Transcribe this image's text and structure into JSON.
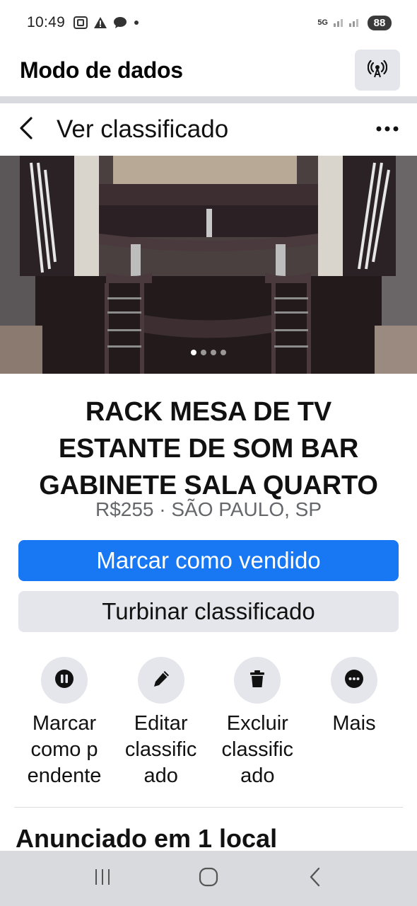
{
  "status_bar": {
    "time": "10:49",
    "network": "5G",
    "battery": "88",
    "left_icons": [
      "screenshot-icon",
      "alert-icon",
      "chat-icon",
      "dot-icon"
    ]
  },
  "data_mode": {
    "title": "Modo de dados",
    "icon": "broadcast-icon"
  },
  "header": {
    "title": "Ver classificado",
    "back_icon": "chevron-left-icon",
    "more_icon": "more-horizontal-icon"
  },
  "photo": {
    "slide_count": 4,
    "active_slide": 1
  },
  "listing": {
    "title_lines": [
      "RACK MESA DE TV",
      "ESTANTE DE SOM BAR",
      "GABINETE SALA QUARTO"
    ],
    "meta": "R$255 · SÃO PAULO, SP"
  },
  "buttons": {
    "mark_sold": "Marcar como vendido",
    "boost": "Turbinar classificado"
  },
  "actions": [
    {
      "label_lines": [
        "Marcar",
        "como p",
        "endente"
      ],
      "icon": "pause-icon"
    },
    {
      "label_lines": [
        "Editar",
        "classific",
        "ado"
      ],
      "icon": "pencil-icon"
    },
    {
      "label_lines": [
        "Excluir",
        "classific",
        "ado"
      ],
      "icon": "trash-icon"
    },
    {
      "label_lines": [
        "Mais"
      ],
      "icon": "more-icon"
    }
  ],
  "section": {
    "title": "Anunciado em 1 local"
  },
  "nav": [
    "recents-icon",
    "home-icon",
    "back-icon"
  ],
  "colors": {
    "primary": "#1877f2",
    "secondary_bg": "#e4e6eb",
    "meta_text": "#65676b"
  }
}
